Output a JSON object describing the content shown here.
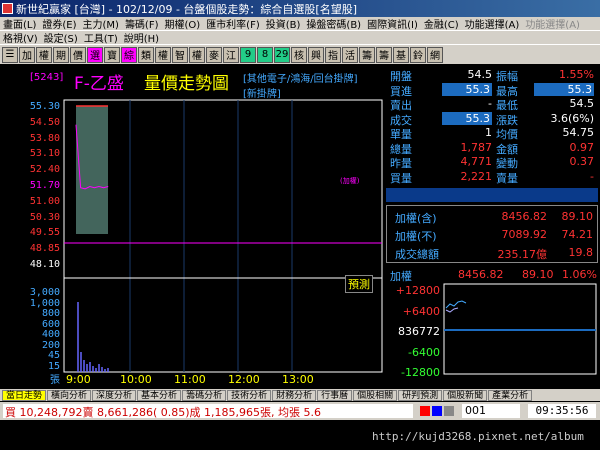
{
  "window": {
    "title": "新世紀贏家 [台灣] - 102/12/09 - 台盤個股走勢：綜合自選股[名望股]"
  },
  "menu1": [
    "畫面(L)",
    "證券(E)",
    "主力(M)",
    "籌碼(F)",
    "期權(O)",
    "匯市利率(F)",
    "投資(B)",
    "操盤密碼(B)",
    "國際資訊(I)",
    "金融(C)",
    "功能選擇(A)",
    "功能選擇(A)"
  ],
  "menu2": [
    "格視(V)",
    "設定(S)",
    "工具(T)",
    "說明(H)"
  ],
  "toolbar": [
    "☰",
    "加",
    "權",
    "期",
    "價",
    "選",
    "寶",
    "綜",
    "類",
    "權",
    "智",
    "權",
    "麥",
    "江",
    "9",
    "8",
    "29",
    "核",
    "興",
    "指",
    "活",
    "籌",
    "籌",
    "基",
    "鈴",
    "網"
  ],
  "stock": {
    "id": "[5243]",
    "name": "F-乙盛",
    "chart_title": "量價走勢圖",
    "category1": "[其他電子/鴻海/回台掛牌]",
    "category2": "[新掛牌]",
    "ref_label": "(加權)",
    "predict_label": "預測"
  },
  "price_axis": [
    {
      "v": "55.30",
      "c": "blue"
    },
    {
      "v": "54.50",
      "c": "red"
    },
    {
      "v": "53.80",
      "c": "red"
    },
    {
      "v": "53.10",
      "c": "red"
    },
    {
      "v": "52.40",
      "c": "red"
    },
    {
      "v": "51.70",
      "c": "mag"
    },
    {
      "v": "51.00",
      "c": "red"
    },
    {
      "v": "50.30",
      "c": "red"
    },
    {
      "v": "49.55",
      "c": "red"
    },
    {
      "v": "48.85",
      "c": "red"
    },
    {
      "v": "48.10",
      "c": "white"
    }
  ],
  "volume_axis": [
    "3,000",
    "1,000",
    "800",
    "600",
    "400",
    "200",
    "45",
    "15",
    "張"
  ],
  "time_axis": [
    "9:00",
    "10:00",
    "11:00",
    "12:00",
    "13:00"
  ],
  "quote": [
    {
      "l": "開盤",
      "v": "54.5",
      "vc": "white",
      "l2": "振幅",
      "v2": "1.55%",
      "v2c": "red"
    },
    {
      "l": "買進",
      "v": "55.3",
      "vc": "boxed",
      "l2": "最高",
      "v2": "55.3",
      "v2c": "boxed"
    },
    {
      "l": "賣出",
      "v": "-",
      "vc": "white",
      "l2": "最低",
      "v2": "54.5",
      "v2c": "white"
    },
    {
      "l": "成交",
      "v": "55.3",
      "vc": "boxed",
      "l2": "漲跌",
      "v2": "3.6(6%)",
      "v2c": "white"
    },
    {
      "l": "單量",
      "v": "1",
      "vc": "white",
      "l2": "均價",
      "v2": "54.75",
      "v2c": "white"
    },
    {
      "l": "總量",
      "v": "1,787",
      "vc": "red",
      "l2": "金額",
      "v2": "0.97",
      "v2c": "red"
    },
    {
      "l": "昨量",
      "v": "4,771",
      "vc": "red",
      "l2": "變動",
      "v2": "0.37",
      "v2c": "red"
    },
    {
      "l": "買量",
      "v": "2,221",
      "vc": "red",
      "l2": "賣量",
      "v2": "-",
      "v2c": "red"
    }
  ],
  "index": [
    {
      "l": "加權(含)",
      "v": "8456.82",
      "v2": "89.10"
    },
    {
      "l": "加權(不)",
      "v": "7089.92",
      "v2": "74.21"
    },
    {
      "l": "成交總額",
      "v": "235.17億",
      "v2": "19.8"
    }
  ],
  "mini": {
    "label": "加權",
    "value": "8456.82",
    "change": "89.10",
    "pct": "1.06%",
    "ticks": [
      "+12800",
      "+6400",
      "836772",
      "-6400",
      "-12800"
    ]
  },
  "tabs": [
    "當日走勢",
    "橫向分析",
    "深度分析",
    "基本分析",
    "籌碼分析",
    "技術分析",
    "財務分析",
    "行事曆",
    "個股相關",
    "研判預測",
    "個股新聞",
    "產業分析"
  ],
  "status": {
    "ticker": "買 10,248,792賣 8,661,286( 0.85)成 1,185,965張, 均張 5.6",
    "page": "001",
    "clock": "09:35:56"
  },
  "watermark": "http://kujd3268.pixnet.net/album",
  "chart_data": {
    "type": "line",
    "x": [
      "9:00",
      "9:05",
      "9:10",
      "9:15",
      "9:20",
      "9:25",
      "9:30",
      "9:35"
    ],
    "series": [
      {
        "values": [
          54.5,
          51.8,
          51.75,
          51.85,
          51.8,
          51.85,
          51.8,
          51.85
        ]
      }
    ],
    "ylim": [
      48.1,
      55.3
    ]
  },
  "colors": {
    "up": "#ff3333",
    "down": "#33ff33",
    "neutral": "#ffffff",
    "accent": "#ff00ff",
    "axis": "#4aaaff"
  }
}
